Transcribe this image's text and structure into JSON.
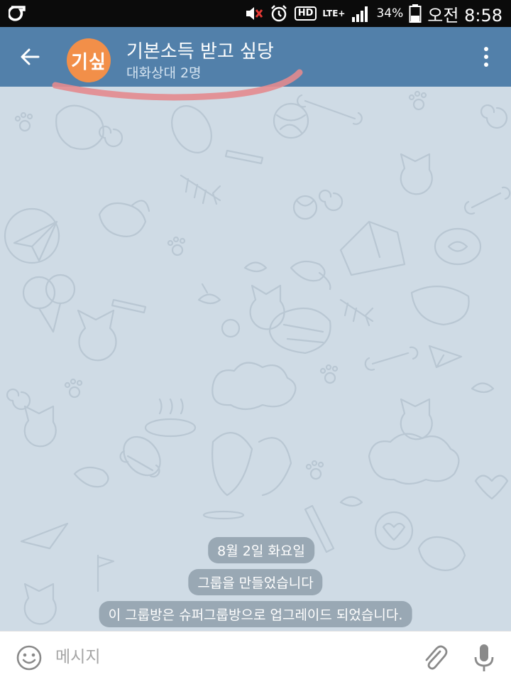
{
  "status_bar": {
    "battery_percent": "34%",
    "ampm": "오전",
    "time": "8:58",
    "hd_label": "HD",
    "lte_label": "LTE+",
    "icons": [
      "app-logo-icon",
      "mute-icon",
      "alarm-icon",
      "hd-voice-icon",
      "lte-icon",
      "signal-icon",
      "battery-icon"
    ]
  },
  "header": {
    "avatar_text": "기싶",
    "title": "기본소득 받고 싶당",
    "subtitle": "대화상대 2명",
    "colors": {
      "header_bg": "#5280aa",
      "avatar_bg": "#f28f49"
    }
  },
  "chat": {
    "service_messages": [
      {
        "text": "8월 2일 화요일"
      },
      {
        "text": "그룹을 만들었습니다"
      },
      {
        "text": "이 그룹방은 슈퍼그룹방으로 업그레이드 되었습니다."
      }
    ]
  },
  "input": {
    "placeholder": "메시지",
    "value": ""
  }
}
